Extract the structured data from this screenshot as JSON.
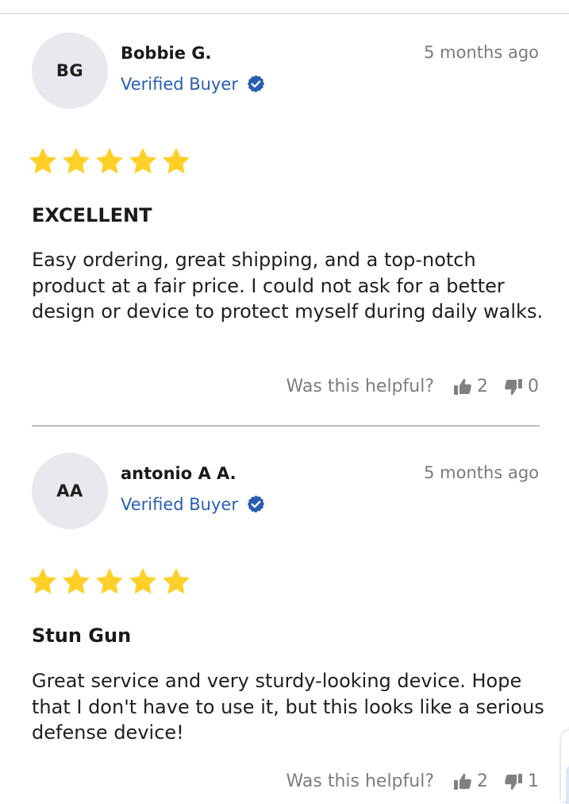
{
  "colors": {
    "star": "#FFD028",
    "verified": "#2A5DB0",
    "muted": "#7A7A7A",
    "divider": "#BDBDBD",
    "avatar_bg": "#E8E8EE"
  },
  "reviews": [
    {
      "initials": "BG",
      "author": "Bobbie G.",
      "verified_label": "Verified Buyer",
      "date": "5 months ago",
      "rating": 5,
      "title": "EXCELLENT",
      "body": "Easy ordering, great shipping, and a top-notch product at a fair price. I could not ask for a better design or device to protect myself during daily walks.",
      "helpful_question": "Was this helpful?",
      "helpful_up": "2",
      "helpful_down": "0"
    },
    {
      "initials": "AA",
      "author": "antonio A A.",
      "verified_label": "Verified Buyer",
      "date": "5 months ago",
      "rating": 5,
      "title": "Stun Gun",
      "body": "Great service and very sturdy-looking device. Hope that I don't have to use it, but this looks like a serious defense device!",
      "helpful_question": "Was this helpful?",
      "helpful_up": "2",
      "helpful_down": "1"
    }
  ]
}
